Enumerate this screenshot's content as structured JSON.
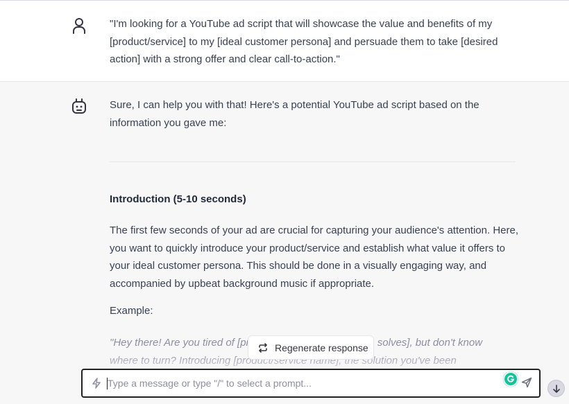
{
  "user_message": {
    "text": "\"I'm looking for a YouTube ad script that will showcase the value and benefits of my [product/service] to my [ideal customer persona] and persuade them to take [desired action] with a strong offer and clear call-to-action.\""
  },
  "assistant_message": {
    "intro": "Sure, I can help you with that! Here's a potential YouTube ad script based on the information you gave me:",
    "heading": "Introduction (5-10 seconds)",
    "paragraph": "The first few seconds of your ad are crucial for capturing your audience's attention. Here, you want to quickly introduce your product/service and establish what value it offers to your ideal customer persona. This should be done in a visually engaging way, and accompanied by upbeat background music if appropriate.",
    "example_label": "Example:",
    "example_quote": "\"Hey there! Are you tired of [problem your product/service solves], but don't know where to turn? Introducing [product/service name], the solution you've been"
  },
  "regenerate_label": "Regenerate response",
  "composer": {
    "placeholder": "Type a message or type \"/\" to select a prompt..."
  },
  "icons": {
    "user": "user-icon",
    "bot": "bot-icon",
    "regenerate": "refresh-icon",
    "bolt": "lightning-icon",
    "grammarly": "grammarly-icon",
    "send": "send-icon",
    "scroll": "arrow-down-icon"
  },
  "colors": {
    "assistant_bg": "#f7f7f8",
    "grammarly": "#15c39a"
  }
}
